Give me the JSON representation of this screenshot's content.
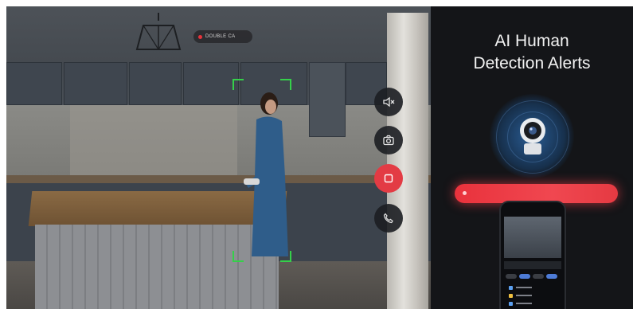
{
  "feed": {
    "rec_label": "DOUBLE CA"
  },
  "controls": [
    {
      "name": "mute-button",
      "icon": "speaker-mute-icon"
    },
    {
      "name": "snapshot-button",
      "icon": "camera-icon"
    },
    {
      "name": "record-button",
      "icon": "record-icon"
    },
    {
      "name": "call-button",
      "icon": "phone-icon"
    }
  ],
  "panel": {
    "title_line1": "AI Human",
    "title_line2": "Detection Alerts"
  },
  "colors": {
    "detection": "#35d04a",
    "record_accent": "#e33b44",
    "alert_bar": "#e9323c",
    "panel_bg": "#141518"
  }
}
